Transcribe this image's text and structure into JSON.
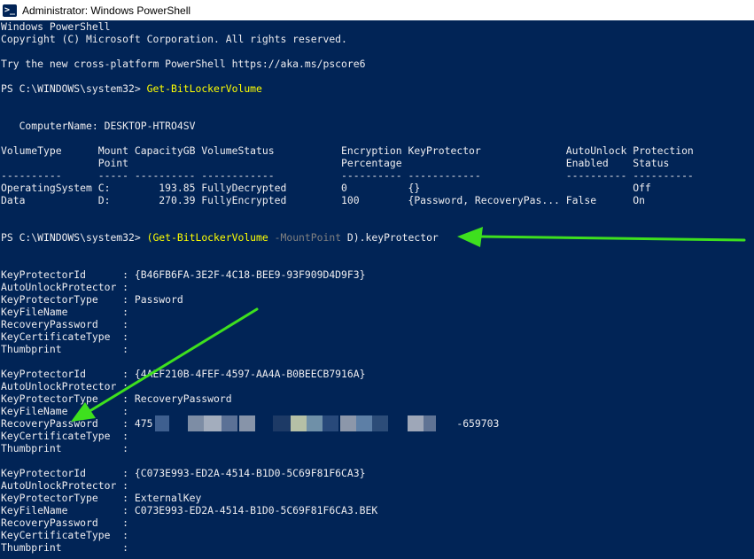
{
  "window": {
    "title": "Administrator: Windows PowerShell",
    "icon": "powershell-icon",
    "icon_glyph": ">_"
  },
  "colors": {
    "background": "#012456",
    "text": "#eeedf0",
    "command": "#ffff00",
    "parameter": "#808080",
    "annotation_arrow": "#3ee01e"
  },
  "console": {
    "banner": [
      "Windows PowerShell",
      "Copyright (C) Microsoft Corporation. All rights reserved.",
      "",
      "Try the new cross-platform PowerShell https://aka.ms/pscore6"
    ],
    "prompt": "PS C:\\WINDOWS\\system32> ",
    "command1": "Get-BitLockerVolume",
    "computer_name_line": "   ComputerName: DESKTOP-HTRO4SV",
    "table_header_1": "VolumeType      Mount CapacityGB VolumeStatus           Encryption KeyProtector              AutoUnlock Protection",
    "table_header_2": "                Point                                   Percentage                           Enabled    Status",
    "table_separator": "----------      ----- ---------- ------------           ---------- ------------              ---------- ----------",
    "table_rows": [
      "OperatingSystem C:        193.85 FullyDecrypted         0          {}                                   Off",
      "Data            D:        270.39 FullyEncrypted         100        {Password, RecoveryPas... False      On"
    ],
    "command2": {
      "open": "(",
      "cmdlet": "Get-BitLockerVolume",
      "param": "-MountPoint",
      "arg": "D",
      "close": ").keyProtector"
    },
    "protectors": [
      [
        "KeyProtectorId      : {B46FB6FA-3E2F-4C18-BEE9-93F909D4D9F3}",
        "AutoUnlockProtector :",
        "KeyProtectorType    : Password",
        "KeyFileName         :",
        "RecoveryPassword    :",
        "KeyCertificateType  :",
        "Thumbprint          :"
      ],
      [
        "KeyProtectorId      : {4AEF210B-4FEF-4597-AA4A-B0BEECB7916A}",
        "AutoUnlockProtector :",
        "KeyProtectorType    : RecoveryPassword",
        "KeyFileName         :",
        "RecoveryPassword    : 475                                                  -659703",
        "KeyCertificateType  :",
        "Thumbprint          :"
      ],
      [
        "KeyProtectorId      : {C073E993-ED2A-4514-B1D0-5C69F81F6CA3}",
        "AutoUnlockProtector :",
        "KeyProtectorType    : ExternalKey",
        "KeyFileName         : C073E993-ED2A-4514-B1D0-5C69F81F6CA3.BEK",
        "RecoveryPassword    :",
        "KeyCertificateType  :",
        "Thumbprint          :"
      ]
    ]
  }
}
